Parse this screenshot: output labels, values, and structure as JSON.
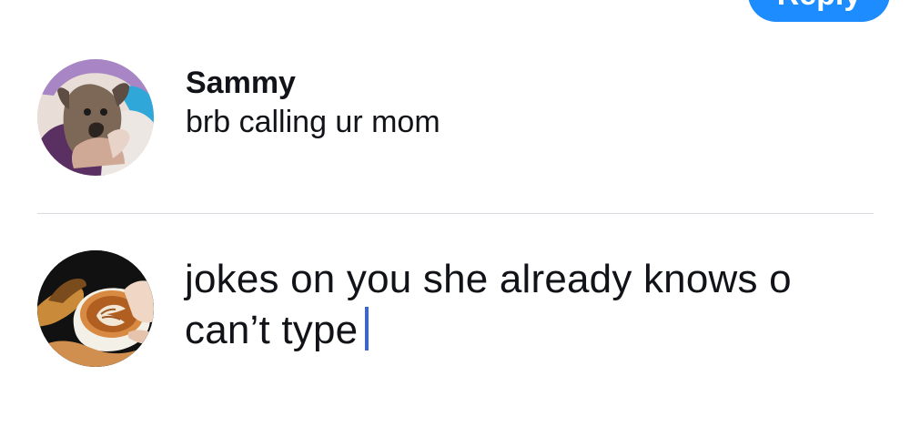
{
  "header": {
    "reply_button_label": "Reply"
  },
  "comment": {
    "author": "Sammy",
    "text": "brb calling ur mom",
    "avatar_icon": "dog-avatar"
  },
  "composer": {
    "avatar_icon": "latte-art-avatar",
    "input_value": "jokes on you she already knows o can’t type",
    "caret_color": "#3d63d8"
  },
  "colors": {
    "accent": "#1d8cff",
    "divider": "#d9dbe0",
    "text": "#111318"
  }
}
